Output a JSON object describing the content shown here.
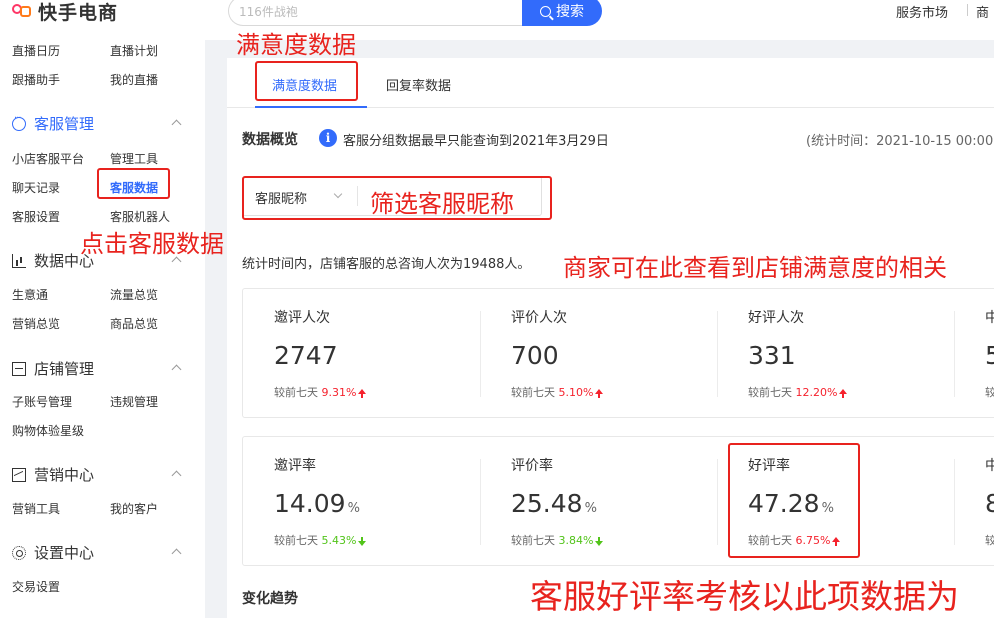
{
  "topbar": {
    "logo_text": "快手电商",
    "search_placeholder": "116件战袍",
    "search_button": "搜索",
    "link_service_market": "服务市场",
    "link_more": "商"
  },
  "sidebar": {
    "items_top": [
      {
        "left": "直播日历",
        "right": "直播计划"
      },
      {
        "left": "跟播助手",
        "right": "我的直播"
      }
    ],
    "groups": [
      {
        "title": "客服管理",
        "icon": "chat-icon",
        "active": true,
        "links": [
          [
            "小店客服平台",
            "管理工具"
          ],
          [
            "聊天记录",
            "客服数据"
          ],
          [
            "客服设置",
            "客服机器人"
          ]
        ]
      },
      {
        "title": "数据中心",
        "icon": "chart-icon",
        "links": [
          [
            "生意通",
            "流量总览"
          ],
          [
            "营销总览",
            "商品总览"
          ]
        ]
      },
      {
        "title": "店铺管理",
        "icon": "shop-icon",
        "links": [
          [
            "子账号管理",
            "违规管理"
          ],
          [
            "购物体验星级",
            ""
          ]
        ]
      },
      {
        "title": "营销中心",
        "icon": "trend-icon",
        "links": [
          [
            "营销工具",
            "我的客户"
          ]
        ]
      },
      {
        "title": "设置中心",
        "icon": "gear-icon",
        "links": [
          [
            "交易设置",
            ""
          ]
        ]
      }
    ]
  },
  "tabs": [
    "满意度数据",
    "回复率数据"
  ],
  "overview": {
    "title": "数据概览",
    "info": "客服分组数据最早只能查询到2021年3月29日",
    "stat_time": "(统计时间：2021-10-15 00:00"
  },
  "filter": {
    "label": "客服昵称"
  },
  "summary": "统计时间内，店铺客服的总咨询人次为19488人。",
  "metrics_row1": [
    {
      "label": "邀评人次",
      "value": "2747",
      "compare_prefix": "较前七天",
      "pct": "9.31%",
      "dir": "up"
    },
    {
      "label": "评价人次",
      "value": "700",
      "compare_prefix": "较前七天",
      "pct": "5.10%",
      "dir": "up"
    },
    {
      "label": "好评人次",
      "value": "331",
      "compare_prefix": "较前七天",
      "pct": "12.20%",
      "dir": "up"
    },
    {
      "label": "中",
      "value": "5",
      "compare_prefix": "较",
      "pct": "",
      "dir": "none"
    }
  ],
  "metrics_row2": [
    {
      "label": "邀评率",
      "value": "14.09",
      "unit": "%",
      "compare_prefix": "较前七天",
      "pct": "5.43%",
      "dir": "down"
    },
    {
      "label": "评价率",
      "value": "25.48",
      "unit": "%",
      "compare_prefix": "较前七天",
      "pct": "3.84%",
      "dir": "down"
    },
    {
      "label": "好评率",
      "value": "47.28",
      "unit": "%",
      "compare_prefix": "较前七天",
      "pct": "6.75%",
      "dir": "up"
    },
    {
      "label": "中",
      "value": "8",
      "unit": "",
      "compare_prefix": "较",
      "pct": "",
      "dir": "none"
    }
  ],
  "trend_title": "变化趋势",
  "annotations": {
    "satisfaction": "满意度数据",
    "click_cs_data": "点击客服数据",
    "filter_nickname": "筛选客服昵称",
    "merchant_view": "商家可在此查看到店铺满意度的相关",
    "assessment": "客服好评率考核以此项数据为"
  },
  "colors": {
    "accent": "#326bfb",
    "annotation": "#e8231e",
    "up": "#f5222d",
    "down": "#52c41a"
  }
}
